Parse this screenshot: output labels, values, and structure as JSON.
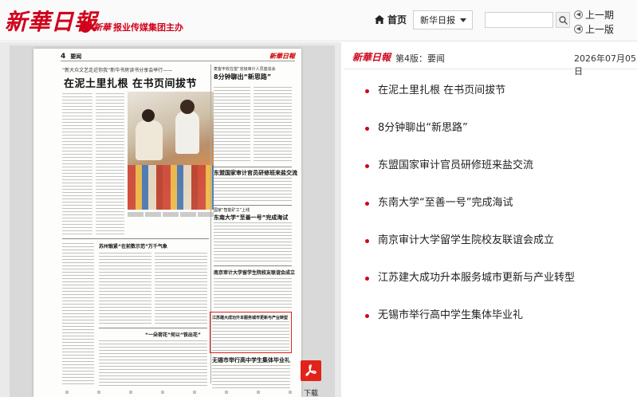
{
  "header": {
    "logo_text": "新華日報",
    "sub_brand": "新華",
    "sub_text": "报业传媒集团主办",
    "home_label": "首页",
    "paper_select": "新华日报",
    "search": {
      "value": "",
      "placeholder": ""
    },
    "prev_issue": "上一期",
    "prev_page": "上一版"
  },
  "newspaper": {
    "page_number": "4",
    "section": "要闻",
    "masthead": "新華日報",
    "kicker": "“新大众文艺走近你我”新华书房读书分享会举行——",
    "main_headline": "在泥土里扎根 在书页间拔节",
    "side_kicker": "麦客丰收在望”省级审计人员座谈会",
    "side_headline": "8分钟聊出“新思路”",
    "mid_headline_1": "东盟国家审计官员研修班来盐交流",
    "mid_kicker_2": "国家“智能矿工”上线",
    "mid_headline_2": "东南大学“至善一号”完成海试",
    "left_headline": "苏州锻紧“在前数示范”万千气象",
    "mid_headline_3": "南京审计大学留学生院校友联谊会成立",
    "boxed_headline": "江苏建大成功升本服务城市更新与产业转型",
    "bottom_headline": "无锡市举行高中学生集体毕业礼",
    "bottom_left_headline": "“一朵荷花”何以“铁出花”",
    "download_label": "下载"
  },
  "list": {
    "logo": "新華日報",
    "edition": "第4版：要闻",
    "date": "2026年07月05日",
    "articles": [
      {
        "title": "在泥土里扎根 在书页间拔节"
      },
      {
        "title": "8分钟聊出“新思路”"
      },
      {
        "title": "东盟国家审计官员研修班来盐交流"
      },
      {
        "title": "东南大学“至善一号”完成海试"
      },
      {
        "title": "南京审计大学留学生院校友联谊会成立"
      },
      {
        "title": "江苏建大成功升本服务城市更新与产业转型"
      },
      {
        "title": "无锡市举行高中学生集体毕业礼"
      }
    ]
  },
  "colors": {
    "brand_red": "#d0021b",
    "highlight_box": "#e2231a"
  },
  "icons": [
    "home-icon",
    "chevron-down-icon",
    "search-icon",
    "circle-arrow-left-icon",
    "pdf-icon"
  ]
}
